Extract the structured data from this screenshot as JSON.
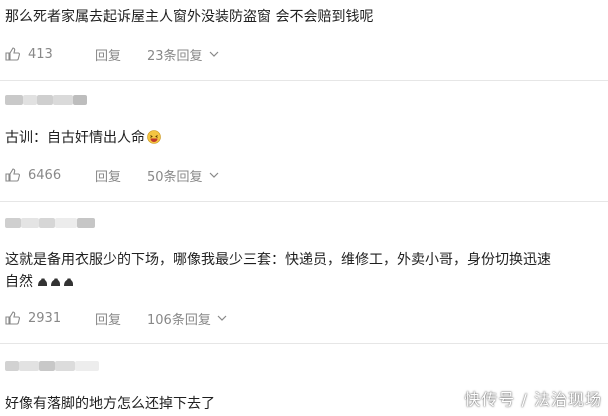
{
  "comments": [
    {
      "text": "那么死者家属去起诉屋主人窗外没装防盗窗 会不会赔到钱呢",
      "likes": "413",
      "reply_label": "回复",
      "reply_count": "23条回复"
    },
    {
      "text": "古训：自古奸情出人命",
      "likes": "6466",
      "reply_label": "回复",
      "reply_count": "50条回复"
    },
    {
      "text_line1": "这就是备用衣服少的下场，哪像我最少三套：快递员，维修工，外卖小哥，身份切换迅速",
      "text_line2": "自然",
      "likes": "2931",
      "reply_label": "回复",
      "reply_count": "106条回复"
    },
    {
      "text": "好像有落脚的地方怎么还掉下去了"
    }
  ],
  "watermark": "快传号 / 法治现场",
  "colors": {
    "text": "#1f1f1f",
    "meta": "#888888",
    "divider": "#e6e6e6"
  }
}
